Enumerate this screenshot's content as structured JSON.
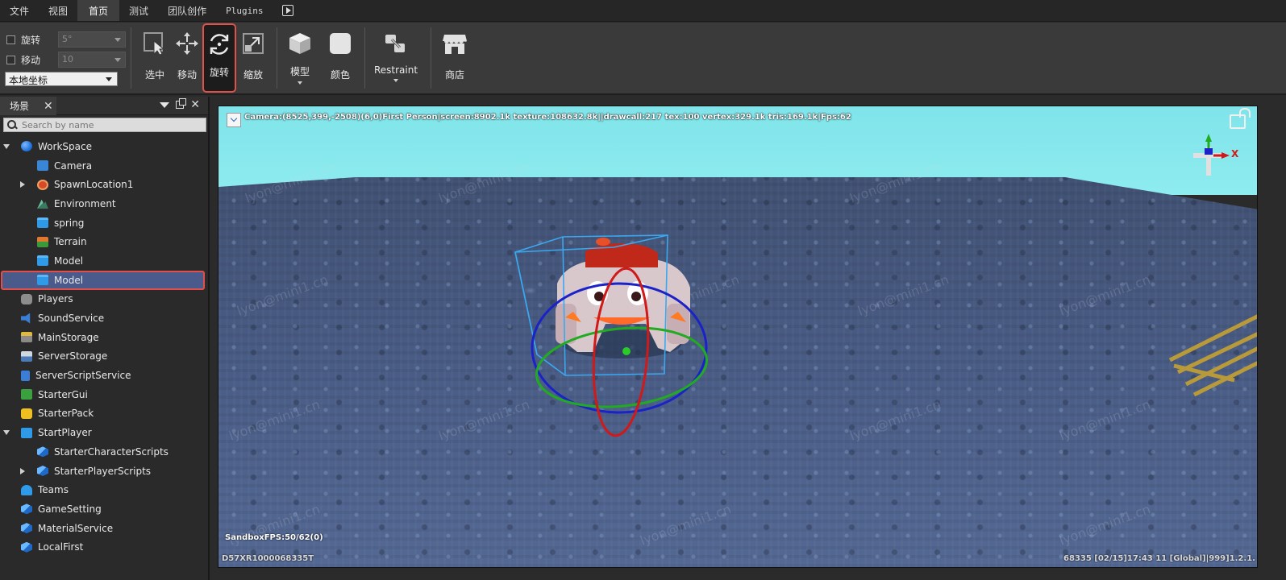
{
  "menubar": {
    "items": [
      "文件",
      "视图",
      "首页",
      "测试",
      "团队创作",
      "Plugins"
    ],
    "active_index": 2
  },
  "toolbar": {
    "rotate_option": {
      "label": "旋转",
      "value": "5°"
    },
    "move_option": {
      "label": "移动",
      "value": "10"
    },
    "coordinate_mode": "本地坐标",
    "tools": {
      "select": "选中",
      "move": "移动",
      "rotate": "旋转",
      "scale": "缩放",
      "model": "模型",
      "color": "颜色",
      "restraint": "Restraint",
      "shop": "商店"
    },
    "selected_tool": "rotate",
    "highlight_color": "#e2504a"
  },
  "scene_panel": {
    "tab_label": "场景",
    "search_placeholder": "Search by name",
    "tree": [
      {
        "label": "WorkSpace",
        "icon": "globe-icon",
        "depth": 0,
        "expander": "down"
      },
      {
        "label": "Camera",
        "icon": "camera-icon",
        "depth": 1
      },
      {
        "label": "SpawnLocation1",
        "icon": "spawn-icon",
        "depth": 1,
        "expander": "right"
      },
      {
        "label": "Environment",
        "icon": "environment-icon",
        "depth": 1
      },
      {
        "label": "spring",
        "icon": "folder-icon",
        "depth": 1
      },
      {
        "label": "Terrain",
        "icon": "terrain-icon",
        "depth": 1
      },
      {
        "label": "Model",
        "icon": "folder-icon",
        "depth": 1
      },
      {
        "label": "Model",
        "icon": "folder-icon",
        "depth": 1,
        "selected": true
      },
      {
        "label": "Players",
        "icon": "players-icon",
        "depth": 0
      },
      {
        "label": "SoundService",
        "icon": "sound-icon",
        "depth": 0
      },
      {
        "label": "MainStorage",
        "icon": "storage-icon",
        "depth": 0
      },
      {
        "label": "ServerStorage",
        "icon": "server-storage-icon",
        "depth": 0
      },
      {
        "label": "ServerScriptService",
        "icon": "script-icon",
        "depth": 0
      },
      {
        "label": "StarterGui",
        "icon": "gui-icon",
        "depth": 0
      },
      {
        "label": "StarterPack",
        "icon": "pack-icon",
        "depth": 0
      },
      {
        "label": "StartPlayer",
        "icon": "start-player-icon",
        "depth": 0,
        "expander": "down"
      },
      {
        "label": "StarterCharacterScripts",
        "icon": "cube-icon",
        "depth": 1
      },
      {
        "label": "StarterPlayerScripts",
        "icon": "cube-icon",
        "depth": 1,
        "expander": "right"
      },
      {
        "label": "Teams",
        "icon": "teams-icon",
        "depth": 0
      },
      {
        "label": "GameSetting",
        "icon": "cube-icon",
        "depth": 0
      },
      {
        "label": "MaterialService",
        "icon": "cube-icon",
        "depth": 0
      },
      {
        "label": "LocalFirst",
        "icon": "cube-icon",
        "depth": 0
      }
    ]
  },
  "viewport": {
    "hud_text": "Camera:(8525,399,-2508)(6,0)First Person|screen:8902.1k texture:108632.8k||drawcall:217 tex:100 vertex:329.1k tris:169.1k|Fps:62",
    "fps_text": "SandboxFPS:50/62(0)",
    "bottom_left": "D57XR1000068335T",
    "bottom_right": "68335   [02/15]17:43 11   [Global]|999]1.2.1.",
    "watermark": "lyon@mini1.cn",
    "axis_x_label": "X",
    "sky_color": "#7fe4ea",
    "gizmo_colors": {
      "x": "#d01a1a",
      "y": "#22aa22",
      "z": "#1a22c8",
      "bbox": "#3aa8f0"
    }
  }
}
